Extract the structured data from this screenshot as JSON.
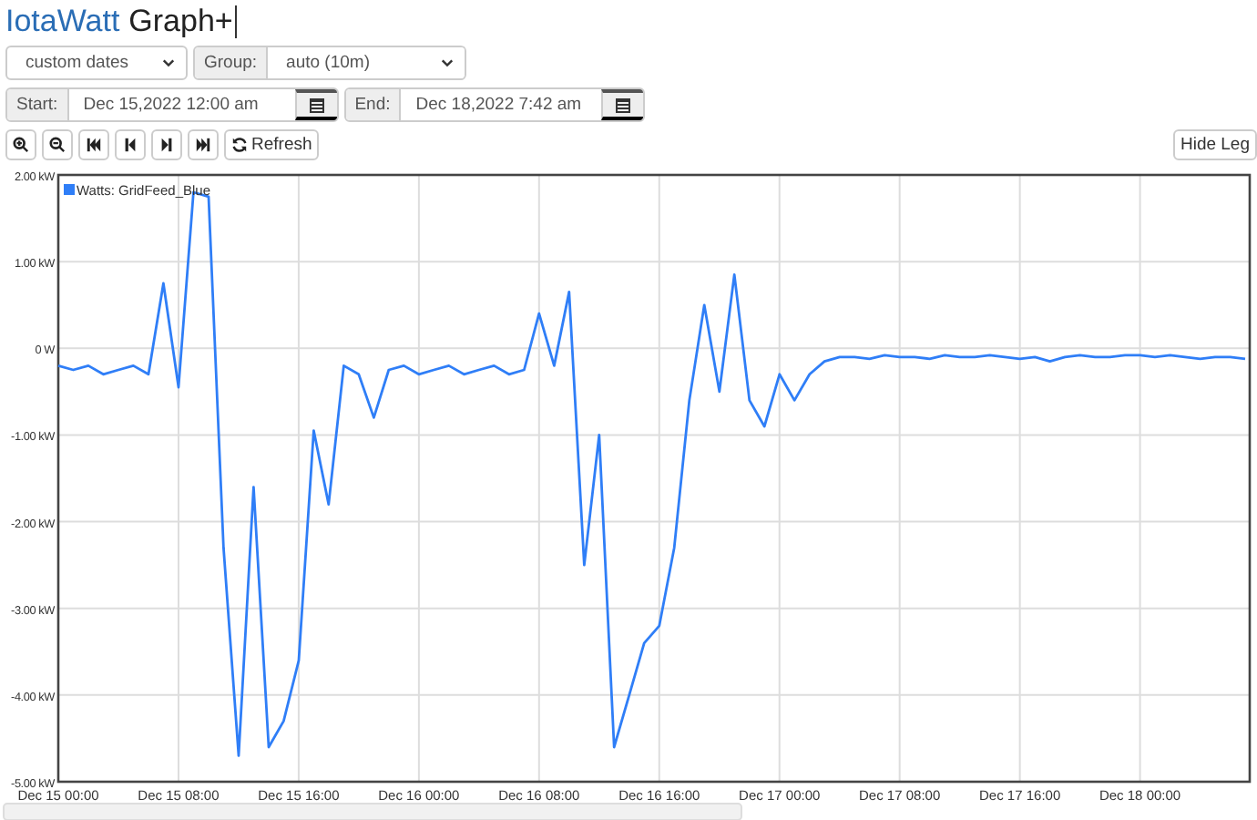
{
  "header": {
    "brand": "IotaWatt",
    "title": "Graph+"
  },
  "controls": {
    "range_select": {
      "value": "custom dates"
    },
    "group": {
      "label": "Group:",
      "value": "auto (10m)"
    },
    "start": {
      "label": "Start:",
      "value": "Dec 15,2022 12:00 am"
    },
    "end": {
      "label": "End:",
      "value": "Dec 18,2022 7:42 am"
    }
  },
  "toolbar": {
    "refresh_label": "Refresh",
    "legend_toggle": "Hide Leg"
  },
  "chart": {
    "chart_data": {
      "type": "line",
      "grid": true,
      "ylim": [
        -5,
        2
      ],
      "yticks": [
        {
          "value": 2,
          "label": "2.00 kW"
        },
        {
          "value": 1,
          "label": "1.00 kW"
        },
        {
          "value": 0,
          "label": "0 W"
        },
        {
          "value": -1,
          "label": "-1.00 kW"
        },
        {
          "value": -2,
          "label": "-2.00 kW"
        },
        {
          "value": -3,
          "label": "-3.00 kW"
        },
        {
          "value": -4,
          "label": "-4.00 kW"
        },
        {
          "value": -5,
          "label": "-5.00 kW"
        }
      ],
      "categories": [
        "Dec 15 00:00",
        null,
        null,
        null,
        null,
        null,
        null,
        null,
        "Dec 15 08:00",
        null,
        null,
        null,
        null,
        null,
        null,
        null,
        "Dec 15 16:00",
        null,
        null,
        null,
        null,
        null,
        null,
        null,
        "Dec 16 00:00",
        null,
        null,
        null,
        null,
        null,
        null,
        null,
        "Dec 16 08:00",
        null,
        null,
        null,
        null,
        null,
        null,
        null,
        "Dec 16 16:00",
        null,
        null,
        null,
        null,
        null,
        null,
        null,
        "Dec 17 00:00",
        null,
        null,
        null,
        null,
        null,
        null,
        null,
        "Dec 17 08:00",
        null,
        null,
        null,
        null,
        null,
        null,
        null,
        "Dec 17 16:00",
        null,
        null,
        null,
        null,
        null,
        null,
        null,
        "Dec 18 00:00",
        null,
        null,
        null,
        null,
        null,
        null,
        null
      ],
      "series": [
        {
          "name": "Watts: GridFeed_Blue",
          "color": "#2f7ef7",
          "values": [
            -0.2,
            -0.25,
            -0.2,
            -0.3,
            -0.25,
            -0.2,
            -0.3,
            0.75,
            -0.45,
            1.8,
            1.75,
            -2.3,
            -4.7,
            -1.6,
            -4.6,
            -4.3,
            -3.6,
            -0.95,
            -1.8,
            -0.2,
            -0.3,
            -0.8,
            -0.25,
            -0.2,
            -0.3,
            -0.25,
            -0.2,
            -0.3,
            -0.25,
            -0.2,
            -0.3,
            -0.25,
            0.4,
            -0.2,
            0.65,
            -2.5,
            -1.0,
            -4.6,
            -4.0,
            -3.4,
            -3.2,
            -2.3,
            -0.6,
            0.5,
            -0.5,
            0.85,
            -0.6,
            -0.9,
            -0.3,
            -0.6,
            -0.3,
            -0.15,
            -0.1,
            -0.1,
            -0.12,
            -0.08,
            -0.1,
            -0.1,
            -0.12,
            -0.08,
            -0.1,
            -0.1,
            -0.08,
            -0.1,
            -0.12,
            -0.1,
            -0.15,
            -0.1,
            -0.08,
            -0.1,
            -0.1,
            -0.08,
            -0.08,
            -0.1,
            -0.08,
            -0.1,
            -0.12,
            -0.1,
            -0.1,
            -0.12
          ]
        }
      ]
    }
  }
}
